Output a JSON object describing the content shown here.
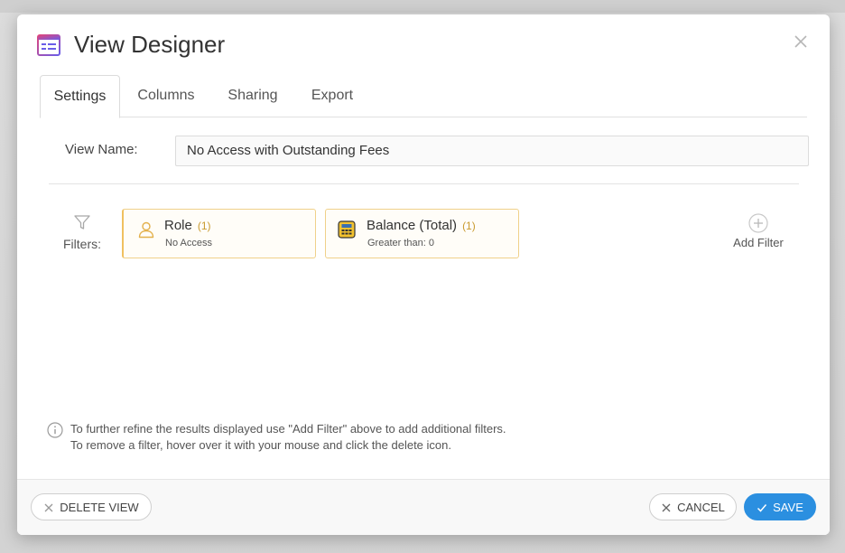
{
  "dialog": {
    "title": "View Designer",
    "title_icon": "view-designer-icon",
    "close_icon": "close-icon"
  },
  "tabs": [
    {
      "label": "Settings",
      "active": true
    },
    {
      "label": "Columns",
      "active": false
    },
    {
      "label": "Sharing",
      "active": false
    },
    {
      "label": "Export",
      "active": false
    }
  ],
  "settings": {
    "view_name_label": "View Name:",
    "view_name_value": "No Access with Outstanding Fees",
    "filters_label": "Filters:",
    "filters": [
      {
        "title": "Role",
        "count": "(1)",
        "subtitle": "No Access",
        "icon": "person-icon"
      },
      {
        "title": "Balance (Total)",
        "count": "(1)",
        "subtitle": "Greater than: 0",
        "icon": "calculator-icon"
      }
    ],
    "add_filter_label": "Add Filter",
    "info_line1": "To further refine the results displayed use \"Add Filter\" above to add additional filters.",
    "info_line2": "To remove a filter, hover over it with your mouse and click the delete icon."
  },
  "footer": {
    "delete_label": "DELETE VIEW",
    "cancel_label": "CANCEL",
    "save_label": "SAVE"
  },
  "colors": {
    "primary": "#2b8fe0",
    "filter_border": "#f0d18a",
    "filter_count": "#c99a2e"
  }
}
